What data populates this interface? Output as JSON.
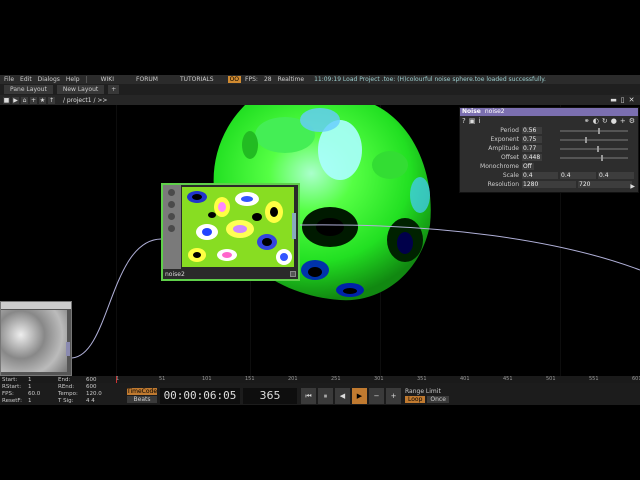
{
  "menu": {
    "items": [
      "File",
      "Edit",
      "Dialogs",
      "Help"
    ],
    "wiki": "WIKI",
    "forum": "FORUM",
    "tutorials": "TUTORIALS",
    "perf_badge": "OO",
    "fps_label": "FPS:",
    "fps_value": "28",
    "realtime": "Realtime",
    "status_message": "11:09:19 Load Project .toe: (H)colourful noise sphere.toe loaded successfully."
  },
  "tabs": {
    "pane_layout": "Pane Layout",
    "new_layout": "New Layout",
    "plus": "+"
  },
  "pathbar": {
    "path": "/ project1 / >>"
  },
  "operator": {
    "name": "noise2"
  },
  "params": {
    "type": "Noise",
    "name": "noise2",
    "rows": [
      {
        "label": "Period",
        "value": "0.56",
        "level": 0.56
      },
      {
        "label": "Exponent",
        "value": "0.75",
        "level": 0.37
      },
      {
        "label": "Amplitude",
        "value": "0.77",
        "level": 0.55
      },
      {
        "label": "Offset",
        "value": "0.448",
        "level": 0.6
      }
    ],
    "monochrome_label": "Monochrome",
    "monochrome_value": "Off",
    "scale_label": "Scale",
    "scale_values": [
      "0.4",
      "0.4",
      "0.4"
    ],
    "resolution_label": "Resolution",
    "resolution_values": [
      "1280",
      "720"
    ]
  },
  "ruler": {
    "marks": [
      "1",
      "51",
      "101",
      "151",
      "201",
      "251",
      "301",
      "351",
      "401",
      "451",
      "501",
      "551",
      "601"
    ]
  },
  "timeline": {
    "start_label": "Start:",
    "start": "1",
    "end_label": "End:",
    "end": "600",
    "rstart_label": "RStart:",
    "rstart": "1",
    "rend_label": "REnd:",
    "rend": "600",
    "fps_label": "FPS:",
    "fps": "60.0",
    "tempo_label": "Tempo:",
    "tempo": "120.0",
    "resetf_label": "ResetF:",
    "resetf": "1",
    "tsig_label": "T Sig:",
    "tsig": "4   4",
    "timecode_btn": "TimeCode",
    "beats_btn": "Beats",
    "timecode": "00:00:06:05",
    "frame": "365",
    "range_label": "Range Limit",
    "loop": "Loop",
    "once": "Once"
  },
  "colors": {
    "accent_orange": "#c07a30",
    "op_border": "#5fd04a",
    "param_header": "#7b6fb0"
  }
}
